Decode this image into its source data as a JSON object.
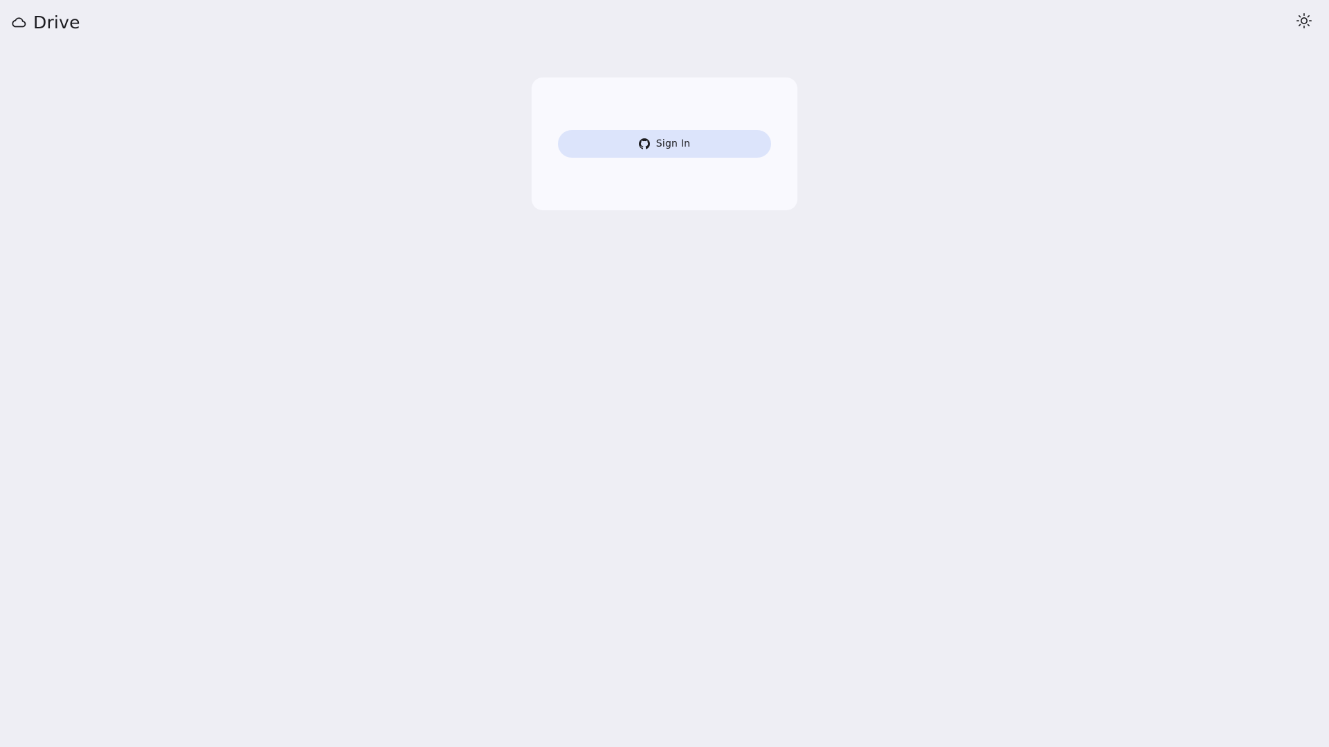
{
  "header": {
    "brand_icon": "cloud-icon",
    "brand_title": "Drive",
    "theme_toggle_icon": "sun-icon"
  },
  "login_card": {
    "signin_icon": "github-icon",
    "signin_label": "Sign In"
  },
  "colors": {
    "page_background": "#eeeef4",
    "card_background": "#f9f9fe",
    "button_background": "#dce4fb",
    "text": "#1b1b1f"
  }
}
